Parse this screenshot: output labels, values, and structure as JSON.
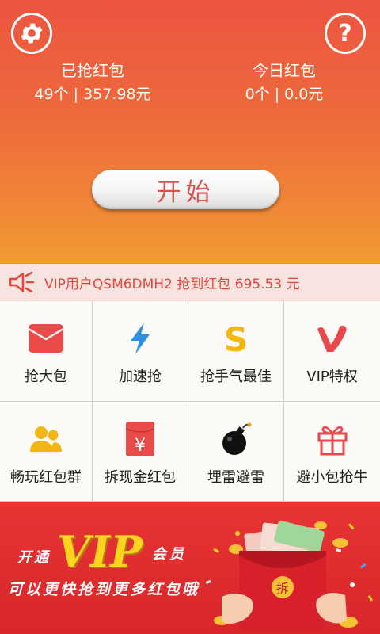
{
  "header": {
    "stats": [
      {
        "label": "已抢红包",
        "value": "49个 | 357.98元"
      },
      {
        "label": "今日红包",
        "value": "0个 | 0.0元"
      }
    ],
    "start_label": "开始",
    "help_glyph": "?"
  },
  "ticker": {
    "text": "VIP用户QSM6DMH2 抢到红包 695.53 元",
    "accent": "#e4473b"
  },
  "grid": [
    {
      "label": "抢大包",
      "icon": "envelope-icon"
    },
    {
      "label": "加速抢",
      "icon": "lightning-icon"
    },
    {
      "label": "抢手气最佳",
      "icon": "dollar-s-icon"
    },
    {
      "label": "VIP特权",
      "icon": "vip-v-icon"
    },
    {
      "label": "畅玩红包群",
      "icon": "group-users-icon"
    },
    {
      "label": "拆现金红包",
      "icon": "yuan-envelope-icon"
    },
    {
      "label": "埋雷避雷",
      "icon": "bomb-icon"
    },
    {
      "label": "避小包抢牛",
      "icon": "gift-icon"
    }
  ],
  "banner": {
    "open": "开通",
    "vip": "VIP",
    "member": "会员",
    "subtitle": "可以更快抢到更多红包哦",
    "envelope_glyph": "拆"
  },
  "colors": {
    "header_top": "#ec5440",
    "header_bottom": "#f29a32",
    "banner_red": "#e73433",
    "vip_yellow": "#ffd41f"
  }
}
